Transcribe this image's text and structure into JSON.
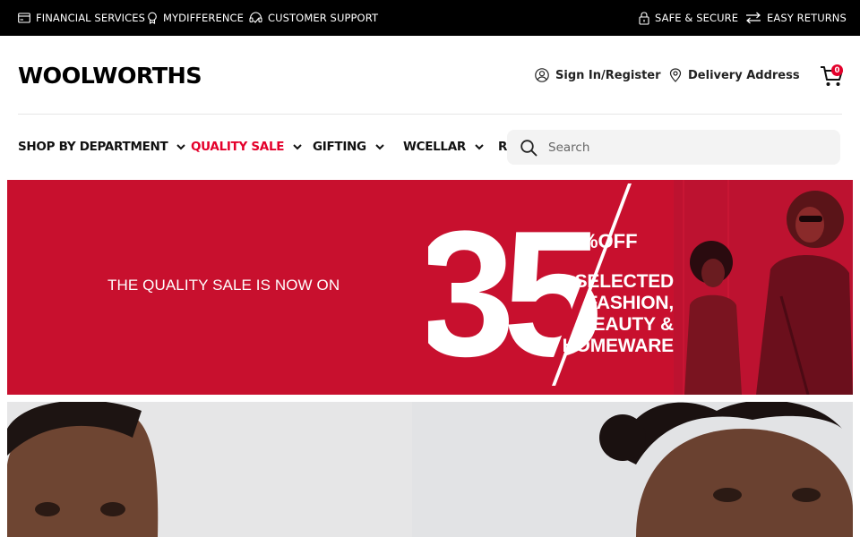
{
  "topbar": {
    "left_links": [
      {
        "label": "FINANCIAL SERVICES",
        "icon": "credit-card-icon"
      },
      {
        "label": "MYDIFFERENCE",
        "icon": "badge-icon"
      },
      {
        "label": "CUSTOMER SUPPORT",
        "icon": "support-icon"
      }
    ],
    "right_links": [
      {
        "label": "SAFE & SECURE",
        "icon": "lock-icon"
      },
      {
        "label": "EASY RETURNS",
        "icon": "returns-icon"
      }
    ]
  },
  "header": {
    "logo": "WOOLWORTHS",
    "sign_in": "Sign In/Register",
    "delivery": "Delivery Address",
    "cart_count": "0"
  },
  "nav": {
    "items": [
      {
        "label": "SHOP BY DEPARTMENT"
      },
      {
        "label": "QUALITY SALE"
      },
      {
        "label": "GIFTING"
      },
      {
        "label": "WCELLAR"
      },
      {
        "label": "R"
      }
    ],
    "search_placeholder": "Search"
  },
  "hero": {
    "headline": "THE QUALITY SALE IS NOW ON",
    "big_number": "35",
    "percent_off": "%OFF",
    "promo_lines": [
      "SELECTED",
      "FASHION,",
      "BEAUTY &",
      "HOMEWARE"
    ]
  },
  "colors": {
    "brand_red": "#e4002b",
    "hero_red": "#c8102e",
    "topbar_bg": "#000000"
  }
}
